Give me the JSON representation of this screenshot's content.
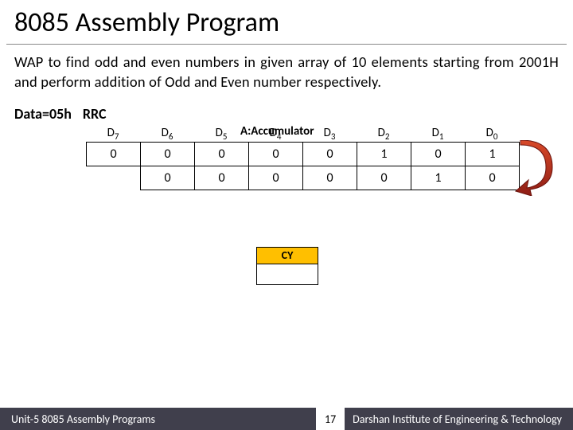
{
  "title": "8085 Assembly Program",
  "body": "WAP to find odd and even numbers in given array of 10 elements starting from 2001H and  perform addition of Odd and Even number respectively.",
  "dataline": {
    "data": "Data=05h",
    "instr": "RRC"
  },
  "diagram": {
    "acc_label": "A:Accumulator",
    "bit_labels": [
      "D",
      "D",
      "D",
      "D",
      "D",
      "D",
      "D",
      "D"
    ],
    "bit_subs": [
      "7",
      "6",
      "5",
      "4",
      "3",
      "2",
      "1",
      "0"
    ],
    "row1": [
      "0",
      "0",
      "0",
      "0",
      "0",
      "1",
      "0",
      "1"
    ],
    "row2": [
      "",
      "0",
      "0",
      "0",
      "0",
      "0",
      "1",
      "0"
    ]
  },
  "cy": {
    "label": "CY",
    "value": ""
  },
  "footer": {
    "unit": "Unit-5 8085 Assembly Programs",
    "page": "17",
    "inst": "Darshan Institute of Engineering & Technology"
  }
}
